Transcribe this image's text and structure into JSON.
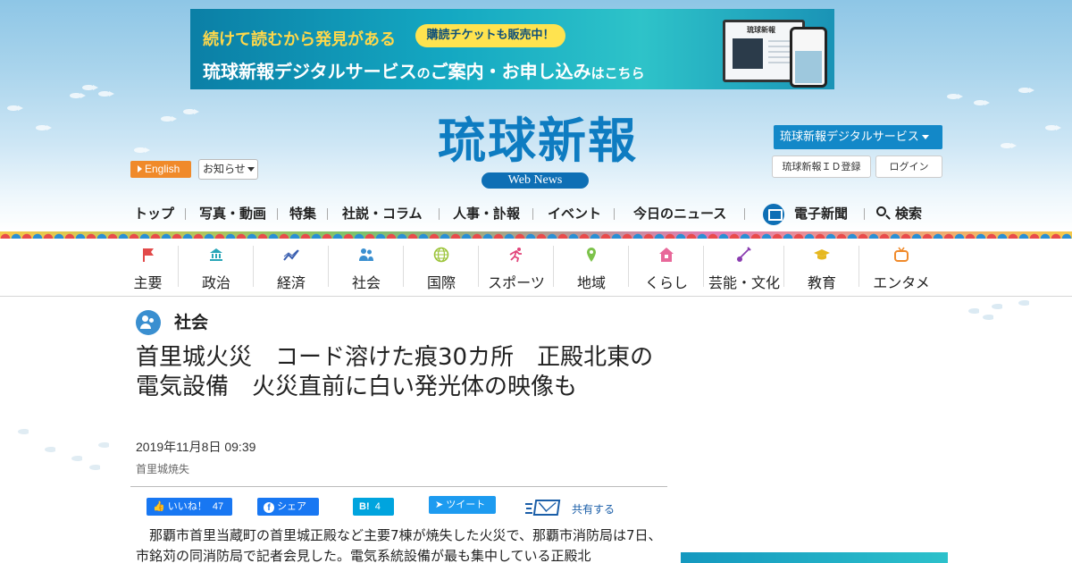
{
  "banner": {
    "line1": "続けて読むから発見がある",
    "pill": "購読チケットも販売中！",
    "line2_main": "琉球新報デジタルサービス",
    "line2_small1": "の",
    "line2_mid": "ご案内・お申し込み",
    "line2_small2": "はこちら",
    "device_header": "琉球新報"
  },
  "header": {
    "english": "English",
    "notice": "お知らせ",
    "logo": "琉球新報",
    "logo_sub": "Web News",
    "digital_service": "琉球新報デジタルサービス",
    "id_register": "琉球新報ＩＤ登録",
    "login": "ログイン"
  },
  "main_nav": [
    "トップ",
    "写真・動画",
    "特集",
    "社説・コラム",
    "人事・訃報",
    "イベント",
    "今日のニュース",
    "電子新聞",
    "検索"
  ],
  "categories": [
    {
      "label": "主要",
      "icon": "flag-icon",
      "color": "#e24a4a"
    },
    {
      "label": "政治",
      "icon": "parliament-icon",
      "color": "#2aa6b8"
    },
    {
      "label": "経済",
      "icon": "trend-chart-icon",
      "color": "#3a5fb0"
    },
    {
      "label": "社会",
      "icon": "people-icon",
      "color": "#3a8fd0"
    },
    {
      "label": "国際",
      "icon": "globe-icon",
      "color": "#9cc43a"
    },
    {
      "label": "スポーツ",
      "icon": "runner-icon",
      "color": "#e2447a"
    },
    {
      "label": "地域",
      "icon": "map-pin-icon",
      "color": "#7cc24a"
    },
    {
      "label": "くらし",
      "icon": "house-icon",
      "color": "#e8689a"
    },
    {
      "label": "芸能・文化",
      "icon": "sanshin-icon",
      "color": "#8a3cb0"
    },
    {
      "label": "教育",
      "icon": "graduation-cap-icon",
      "color": "#e6b820"
    },
    {
      "label": "エンタメ",
      "icon": "tv-icon",
      "color": "#f08a2a"
    }
  ],
  "article": {
    "section": "社会",
    "headline": "首里城火災　コード溶けた痕30カ所　正殿北東の電気設備　火災直前に白い発光体の映像も",
    "date": "2019年11月8日 09:39",
    "tag": "首里城焼失",
    "body": "那覇市首里当蔵町の首里城正殿など主要7棟が焼失した火災で、那覇市消防局は7日、市銘苅の同消防局で記者会見した。電気系統設備が最も集中している正殿北"
  },
  "share": {
    "fb_like": "いいね！",
    "fb_like_count": "47",
    "fb_share": "シェア",
    "hatena_label": "B!",
    "hatena_count": "4",
    "tweet": "ツイート",
    "mail": "共有する"
  }
}
